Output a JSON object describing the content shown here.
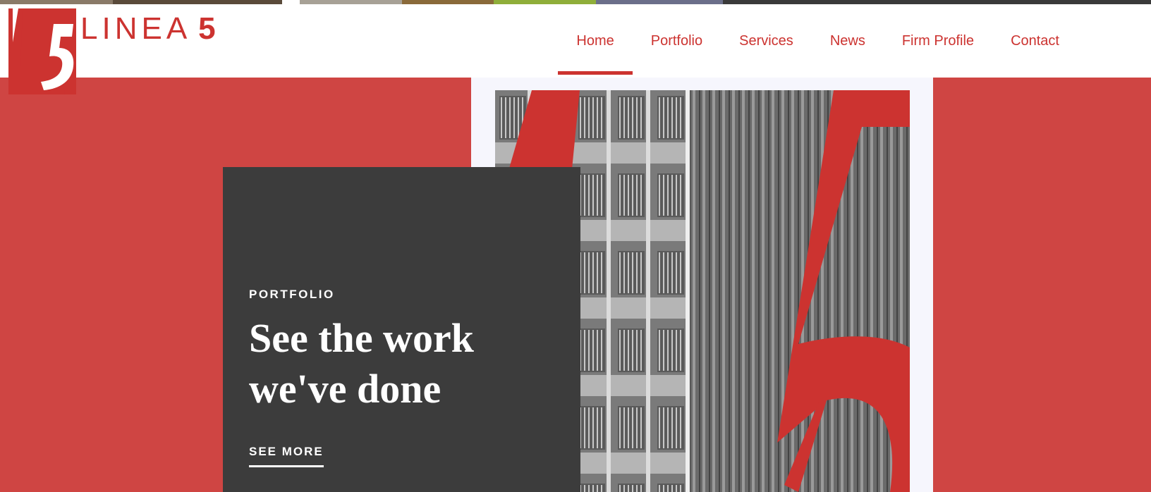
{
  "brand": {
    "logo_word": "LINEA",
    "logo_number": "5",
    "brand_color": "#cc3330"
  },
  "nav": {
    "items": [
      {
        "label": "Home",
        "active": true
      },
      {
        "label": "Portfolio",
        "active": false
      },
      {
        "label": "Services",
        "active": false
      },
      {
        "label": "News",
        "active": false
      },
      {
        "label": "Firm Profile",
        "active": false
      },
      {
        "label": "Contact",
        "active": false
      }
    ]
  },
  "hero": {
    "background_color": "#cf4543",
    "card": {
      "kicker": "PORTFOLIO",
      "title": "See the work we've done",
      "cta_label": "SEE MORE"
    }
  },
  "icons": [
    "linea5-logo-mark",
    "building-facade-image"
  ]
}
